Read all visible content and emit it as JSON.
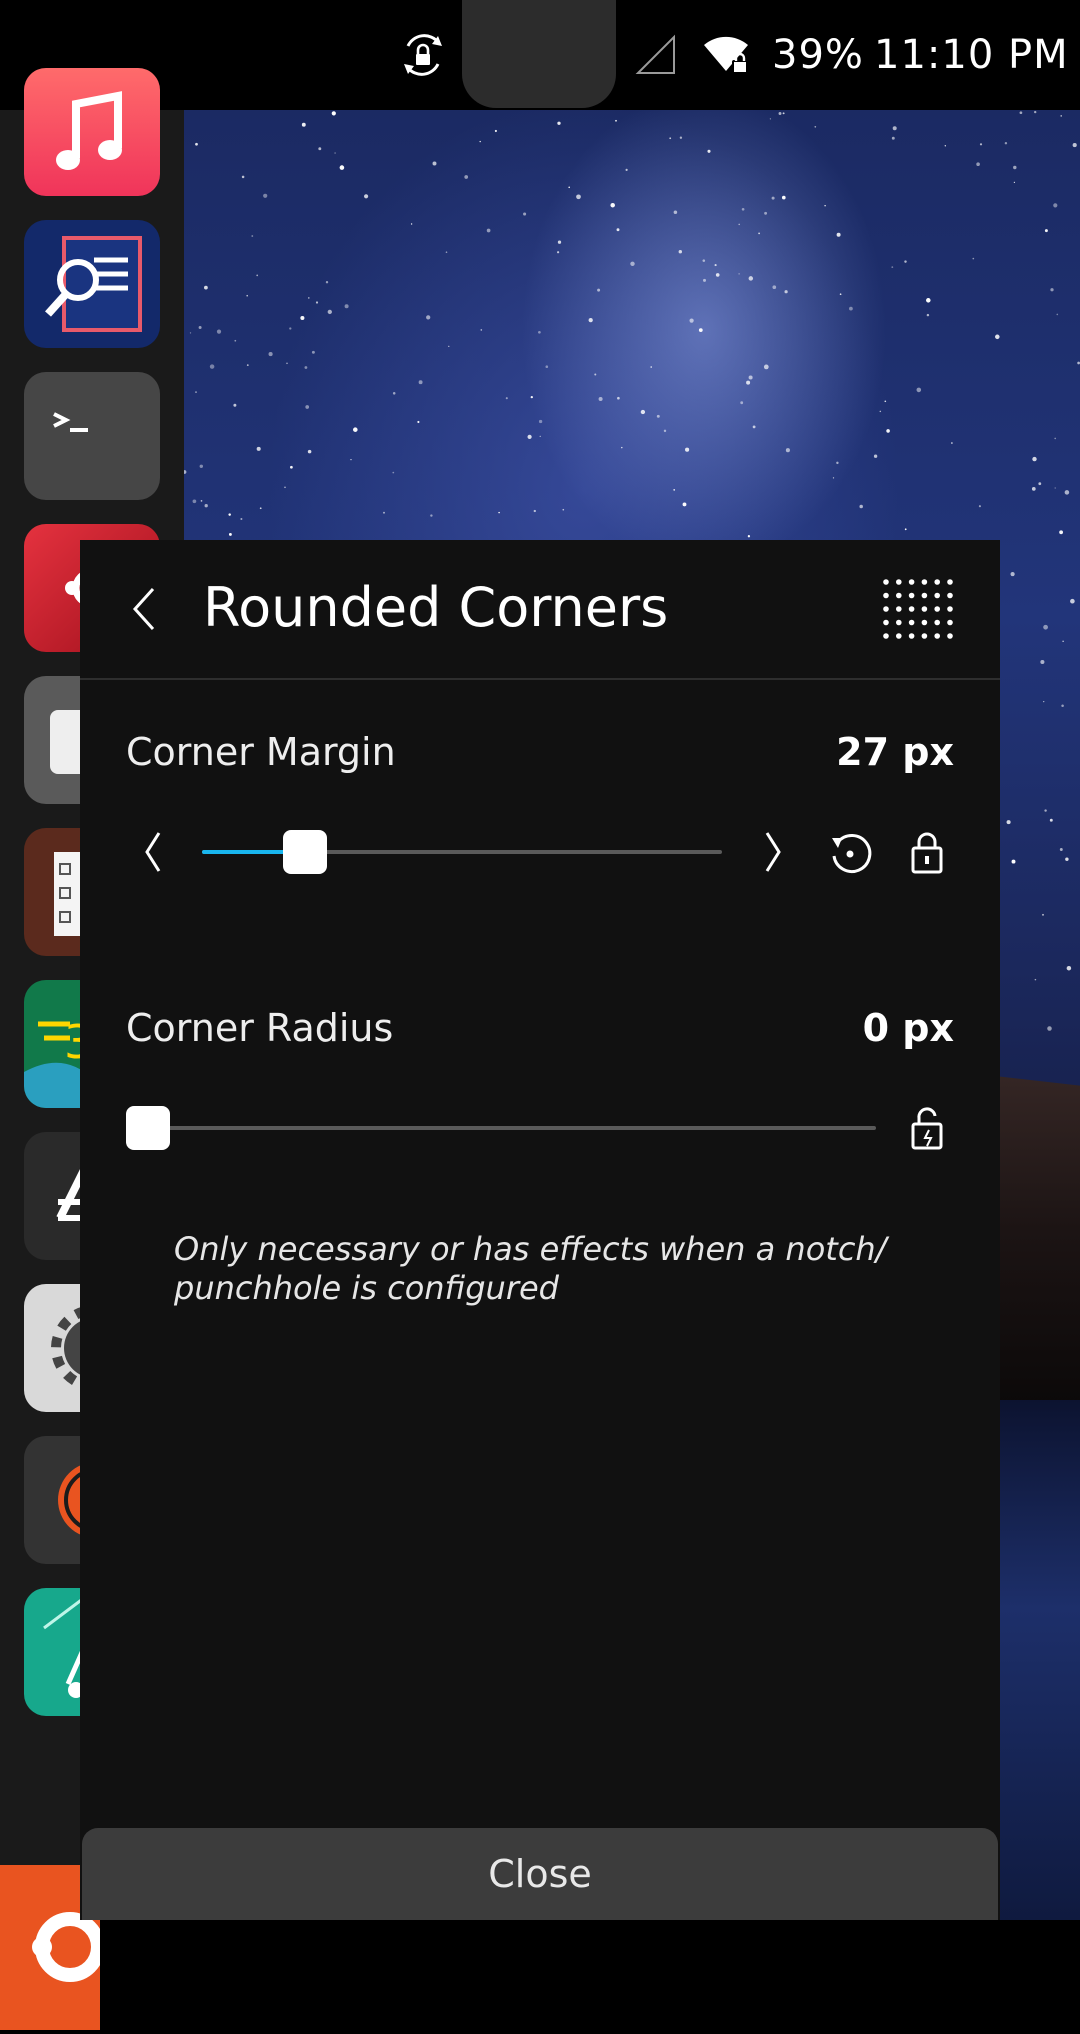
{
  "status_bar": {
    "battery": "39%",
    "time": "11:10 PM",
    "icons": [
      "rotation-lock-icon",
      "cellular-signal-icon",
      "wifi-secure-icon"
    ]
  },
  "launcher": {
    "apps": [
      {
        "name": "music-app-icon",
        "color": "#f0455a"
      },
      {
        "name": "document-viewer-app-icon",
        "color": "#13296a"
      },
      {
        "name": "terminal-app-icon",
        "color": "#464646"
      },
      {
        "name": "ubuntu-app-icon",
        "color": "#c7162b"
      },
      {
        "name": "gray-app-icon",
        "color": "#5a5a5a"
      },
      {
        "name": "notes-app-icon",
        "color": "#5b2a1d"
      },
      {
        "name": "green-app-icon",
        "color": "#11794a"
      },
      {
        "name": "store-app-icon",
        "color": "#2a2a2a"
      },
      {
        "name": "settings-app-icon",
        "color": "#d9d9d9"
      },
      {
        "name": "basketball-app-icon",
        "color": "#333333"
      },
      {
        "name": "teal-app-icon",
        "color": "#17a88c"
      }
    ],
    "home_button": "ubuntu-home-icon"
  },
  "panel": {
    "title": "Rounded Corners",
    "back_icon": "chevron-left-icon",
    "menu_icon": "grid-dots-icon",
    "corner_margin": {
      "label": "Corner Margin",
      "value": "27 px",
      "slider_fraction": 0.17
    },
    "corner_radius": {
      "label": "Corner Radius",
      "value": "0 px",
      "slider_fraction": 0.0
    },
    "note": "Only necessary or has effects when a notch/ punchhole is configured",
    "close_label": "Close"
  },
  "colors": {
    "accent": "#19b6ee",
    "panel_bg": "#111111",
    "close_bg": "#3c3c3c",
    "home_orange": "#e95420"
  }
}
